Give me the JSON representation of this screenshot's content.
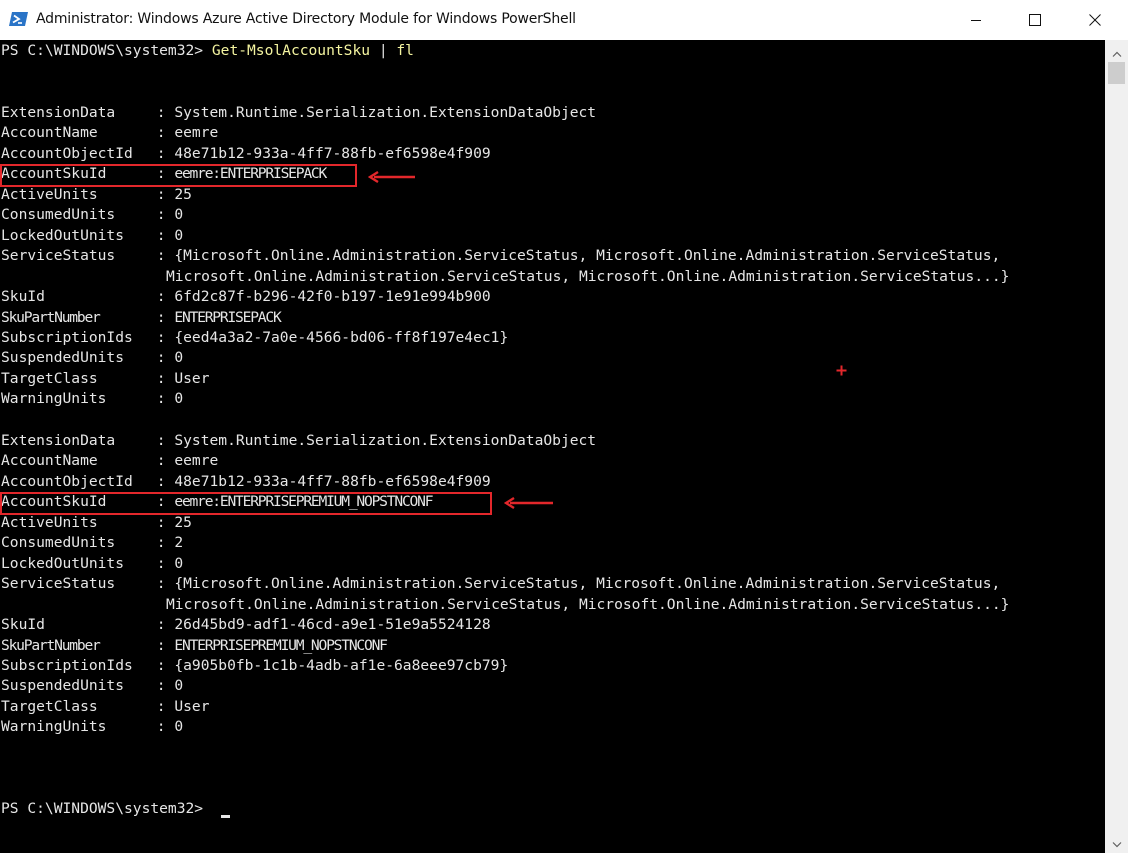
{
  "window": {
    "title": "Administrator: Windows Azure Active Directory Module for Windows PowerShell",
    "icons": {
      "app": "powershell-icon",
      "minimize": "minimize-icon",
      "maximize": "maximize-icon",
      "close": "close-icon"
    }
  },
  "console": {
    "prompt": "PS C:\\WINDOWS\\system32> ",
    "command": "Get-MsolAccountSku",
    "pipe": " | ",
    "pipe_arg": "fl",
    "separator": " : ",
    "records": [
      {
        "fields": [
          {
            "key": "ExtensionData",
            "value": "System.Runtime.Serialization.ExtensionDataObject"
          },
          {
            "key": "AccountName",
            "value": "eemre"
          },
          {
            "key": "AccountObjectId",
            "value": "48e71b12-933a-4ff7-88fb-ef6598e4f909"
          },
          {
            "key": "AccountSkuId",
            "value": "eemre:ENTERPRISEPACK"
          },
          {
            "key": "ActiveUnits",
            "value": "25"
          },
          {
            "key": "ConsumedUnits",
            "value": "0"
          },
          {
            "key": "LockedOutUnits",
            "value": "0"
          },
          {
            "key": "ServiceStatus",
            "value": "{Microsoft.Online.Administration.ServiceStatus, Microsoft.Online.Administration.ServiceStatus,",
            "continuation": "Microsoft.Online.Administration.ServiceStatus, Microsoft.Online.Administration.ServiceStatus...}"
          },
          {
            "key": "SkuId",
            "value": "6fd2c87f-b296-42f0-b197-1e91e994b900"
          },
          {
            "key": "SkuPartNumber",
            "value": "ENTERPRISEPACK"
          },
          {
            "key": "SubscriptionIds",
            "value": "{eed4a3a2-7a0e-4566-bd06-ff8f197e4ec1}"
          },
          {
            "key": "SuspendedUnits",
            "value": "0"
          },
          {
            "key": "TargetClass",
            "value": "User"
          },
          {
            "key": "WarningUnits",
            "value": "0"
          }
        ]
      },
      {
        "fields": [
          {
            "key": "ExtensionData",
            "value": "System.Runtime.Serialization.ExtensionDataObject"
          },
          {
            "key": "AccountName",
            "value": "eemre"
          },
          {
            "key": "AccountObjectId",
            "value": "48e71b12-933a-4ff7-88fb-ef6598e4f909"
          },
          {
            "key": "AccountSkuId",
            "value": "eemre:ENTERPRISEPREMIUM_NOPSTNCONF"
          },
          {
            "key": "ActiveUnits",
            "value": "25"
          },
          {
            "key": "ConsumedUnits",
            "value": "2"
          },
          {
            "key": "LockedOutUnits",
            "value": "0"
          },
          {
            "key": "ServiceStatus",
            "value": "{Microsoft.Online.Administration.ServiceStatus, Microsoft.Online.Administration.ServiceStatus,",
            "continuation": "Microsoft.Online.Administration.ServiceStatus, Microsoft.Online.Administration.ServiceStatus...}"
          },
          {
            "key": "SkuId",
            "value": "26d45bd9-adf1-46cd-a9e1-51e9a5524128"
          },
          {
            "key": "SkuPartNumber",
            "value": "ENTERPRISEPREMIUM_NOPSTNCONF"
          },
          {
            "key": "SubscriptionIds",
            "value": "{a905b0fb-1c1b-4adb-af1e-6a8eee97cb79}"
          },
          {
            "key": "SuspendedUnits",
            "value": "0"
          },
          {
            "key": "TargetClass",
            "value": "User"
          },
          {
            "key": "WarningUnits",
            "value": "0"
          }
        ]
      }
    ],
    "final_prompt": "PS C:\\WINDOWS\\system32> "
  },
  "annotations": {
    "highlight_color": "#e3272b",
    "icons": {
      "arrow": "left-arrow-icon",
      "marker": "plus-marker-icon"
    }
  },
  "colors": {
    "console_bg": "#000000",
    "console_fg": "#e6e6e6",
    "command_fg": "#f4f4a0",
    "titlebar_bg": "#ffffff"
  }
}
